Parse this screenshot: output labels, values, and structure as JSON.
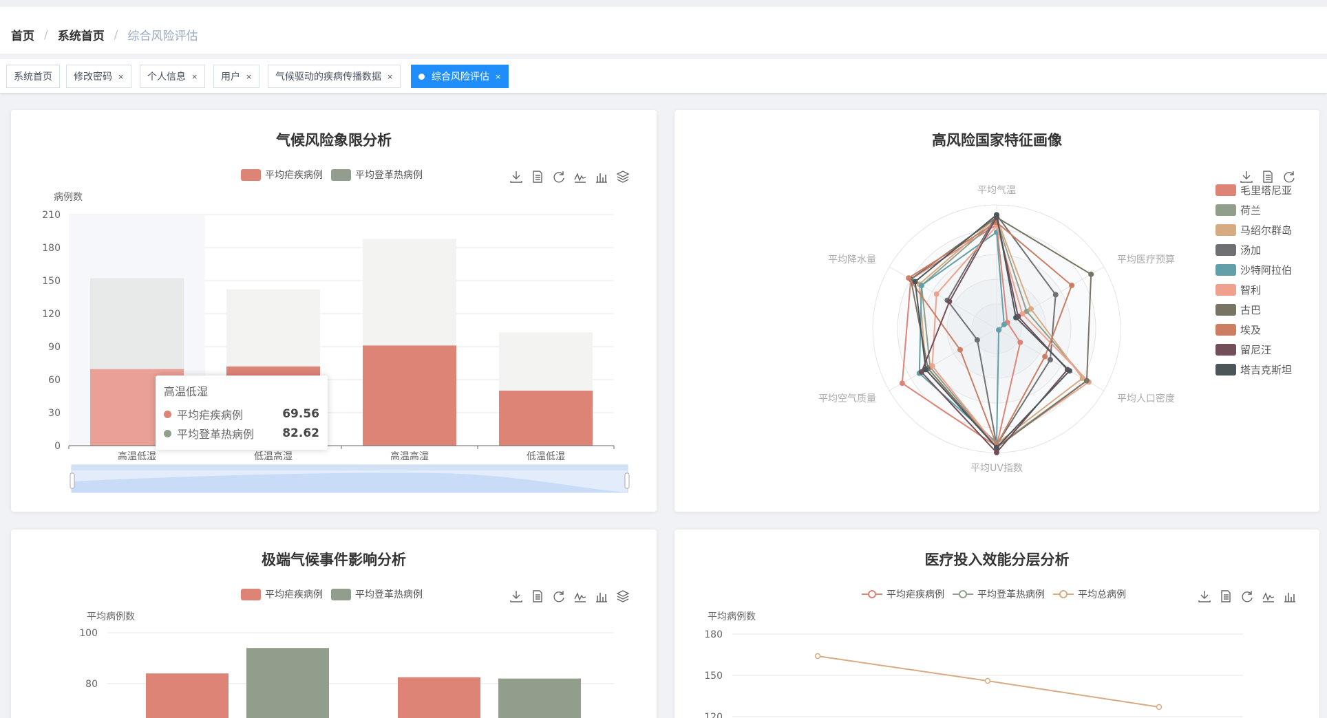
{
  "breadcrumb": [
    "首页",
    "系统首页",
    "综合风险评估"
  ],
  "tags": [
    {
      "label": "系统首页",
      "closable": false,
      "active": false
    },
    {
      "label": "修改密码",
      "closable": true,
      "active": false
    },
    {
      "label": "个人信息",
      "closable": true,
      "active": false
    },
    {
      "label": "用户",
      "closable": true,
      "active": false
    },
    {
      "label": "气候驱动的疾病传播数据",
      "closable": true,
      "active": false
    },
    {
      "label": "综合风险评估",
      "closable": true,
      "active": true
    }
  ],
  "tag_close_glyph": "×",
  "colors": {
    "malaria": "#dd8477",
    "dengue": "#919e8b",
    "total": "#d7ab82",
    "active_tab": "#1f8efa"
  },
  "cards": {
    "quadrant": {
      "title": "气候风险象限分析",
      "legend": [
        "平均疟疾病例",
        "平均登革热病例"
      ],
      "y_axis_title": "病例数",
      "tooltip": {
        "title": "高温低湿",
        "rows": [
          {
            "label": "平均疟疾病例",
            "value": "69.56"
          },
          {
            "label": "平均登革热病例",
            "value": "82.62"
          }
        ]
      }
    },
    "radar": {
      "title": "高风险国家特征画像"
    },
    "extreme": {
      "title": "极端气候事件影响分析",
      "legend": [
        "平均疟疾病例",
        "平均登革热病例"
      ],
      "y_axis_title": "平均病例数"
    },
    "medical": {
      "title": "医疗投入效能分层分析",
      "legend": [
        "平均疟疾病例",
        "平均登革热病例",
        "平均总病例"
      ],
      "y_axis_title": "平均病例数"
    }
  },
  "toolbox_icons": [
    "download-icon",
    "data-view-icon",
    "refresh-icon",
    "line-chart-icon",
    "bar-chart-icon",
    "stack-icon"
  ],
  "chart_data": [
    {
      "type": "bar",
      "title": "气候风险象限分析",
      "ylabel": "病例数",
      "categories": [
        "高温低湿",
        "低温高湿",
        "高温高湿",
        "低温低湿"
      ],
      "series": [
        {
          "name": "平均疟疾病例",
          "values": [
            69.56,
            72,
            91,
            50
          ]
        },
        {
          "name": "平均登革热病例",
          "values": [
            82.62,
            70,
            97,
            53
          ]
        }
      ],
      "stacked": true,
      "ylim": [
        0,
        210
      ],
      "yticks": [
        0,
        30,
        60,
        90,
        120,
        150,
        180,
        210
      ],
      "legend_position": "top",
      "datazoom": true
    },
    {
      "type": "radar",
      "title": "高风险国家特征画像",
      "indicators": [
        "平均气温",
        "平均医疗预算",
        "平均人口密度",
        "平均UV指数",
        "平均空气质量",
        "平均降水量"
      ],
      "series": [
        {
          "name": "毛里塔尼亚",
          "color": "#dd8477",
          "values": [
            0.84,
            0.1,
            0.22,
            0.95,
            0.88,
            0.8
          ]
        },
        {
          "name": "荷兰",
          "color": "#919e8b",
          "values": [
            0.88,
            0.28,
            0.84,
            0.95,
            0.62,
            0.7
          ]
        },
        {
          "name": "马绍尔群岛",
          "color": "#d7ab82",
          "values": [
            0.9,
            0.32,
            0.8,
            0.93,
            0.66,
            0.72
          ]
        },
        {
          "name": "汤加",
          "color": "#6e7074",
          "values": [
            0.92,
            0.55,
            0.5,
            0.94,
            0.18,
            0.46
          ]
        },
        {
          "name": "沙特阿拉伯",
          "color": "#61a0a8",
          "values": [
            0.78,
            0.07,
            0.02,
            0.92,
            0.72,
            0.7
          ]
        },
        {
          "name": "智利",
          "color": "#efa18d",
          "values": [
            0.83,
            0.24,
            0.86,
            0.95,
            0.6,
            0.56
          ]
        },
        {
          "name": "古巴",
          "color": "#787464",
          "values": [
            0.9,
            0.88,
            0.84,
            0.96,
            0.64,
            0.8
          ]
        },
        {
          "name": "埃及",
          "color": "#cc7e63",
          "values": [
            0.86,
            0.7,
            0.45,
            0.94,
            0.34,
            0.82
          ]
        },
        {
          "name": "留尼汪",
          "color": "#724e58",
          "values": [
            0.9,
            0.2,
            0.66,
            1.0,
            0.7,
            0.44
          ]
        },
        {
          "name": "塔吉克斯坦",
          "color": "#4b565b",
          "values": [
            0.92,
            0.18,
            0.68,
            0.96,
            0.66,
            0.76
          ]
        }
      ]
    },
    {
      "type": "bar",
      "title": "极端气候事件影响分析",
      "ylabel": "平均病例数",
      "series": [
        {
          "name": "平均疟疾病例",
          "values": [
            84.0,
            82.5
          ]
        },
        {
          "name": "平均登革热病例",
          "values": [
            94.0,
            82.0
          ]
        }
      ],
      "yticks_visible": [
        80,
        100
      ]
    },
    {
      "type": "line",
      "title": "医疗投入效能分层分析",
      "ylabel": "平均病例数",
      "series": [
        {
          "name": "平均疟疾病例",
          "values": []
        },
        {
          "name": "平均登革热病例",
          "values": []
        },
        {
          "name": "平均总病例",
          "values": [
            164,
            146,
            127
          ]
        }
      ],
      "yticks_visible": [
        120,
        150,
        180
      ]
    }
  ]
}
